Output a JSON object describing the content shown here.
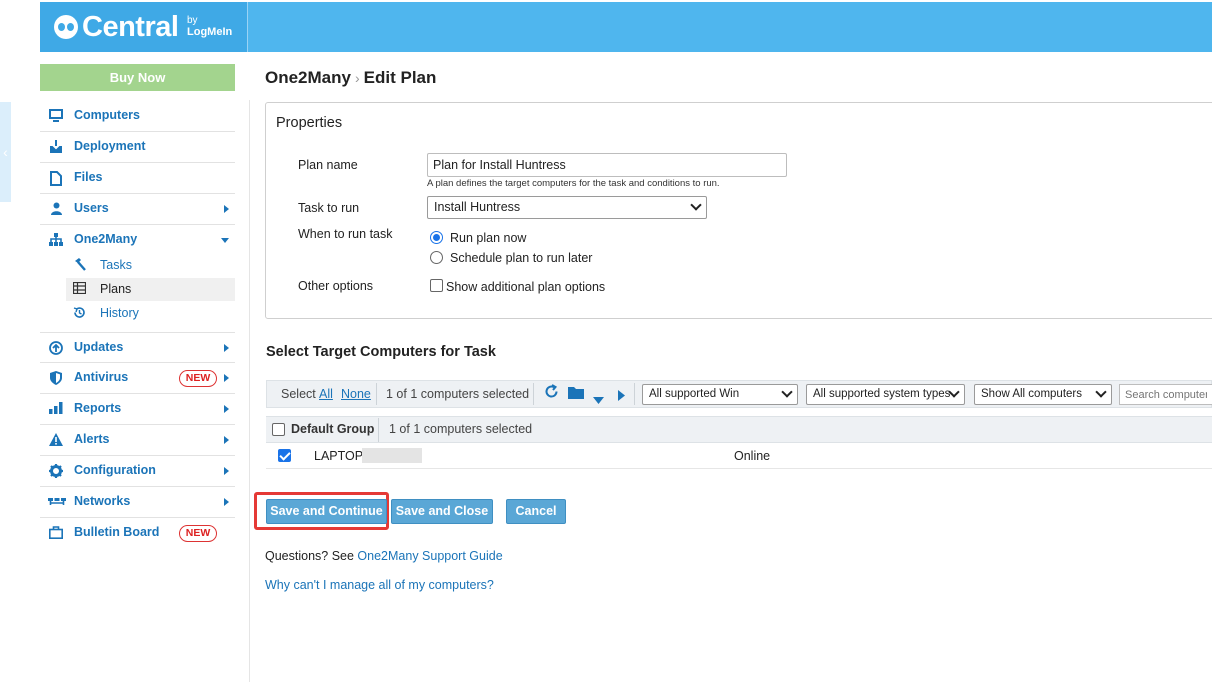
{
  "brand": {
    "name": "Central",
    "by": "by",
    "logmein": "LogMeIn"
  },
  "sidebar": {
    "collapse_glyph": "‹",
    "buy_now": "Buy Now",
    "items": [
      {
        "label": "Computers",
        "icon": "monitor-icon"
      },
      {
        "label": "Deployment",
        "icon": "download-icon"
      },
      {
        "label": "Files",
        "icon": "file-icon"
      },
      {
        "label": "Users",
        "icon": "user-icon"
      },
      {
        "label": "One2Many",
        "icon": "sitemap-icon"
      },
      {
        "label": "Updates",
        "icon": "arrow-up-circle-icon"
      },
      {
        "label": "Antivirus",
        "icon": "shield-icon",
        "badge": "NEW"
      },
      {
        "label": "Reports",
        "icon": "bar-chart-icon"
      },
      {
        "label": "Alerts",
        "icon": "warning-icon"
      },
      {
        "label": "Configuration",
        "icon": "gear-icon"
      },
      {
        "label": "Networks",
        "icon": "network-icon"
      },
      {
        "label": "Bulletin Board",
        "icon": "briefcase-icon",
        "badge": "NEW"
      }
    ],
    "subitems": [
      {
        "label": "Tasks",
        "icon": "hammer-icon"
      },
      {
        "label": "Plans",
        "icon": "table-icon",
        "active": true
      },
      {
        "label": "History",
        "icon": "history-icon"
      }
    ]
  },
  "breadcrumb": {
    "parent": "One2Many",
    "separator": "›",
    "current": "Edit Plan"
  },
  "properties": {
    "title": "Properties",
    "plan_name_label": "Plan name",
    "plan_name_value": "Plan for Install Huntress",
    "plan_name_hint": "A plan defines the target computers for the task and conditions to run.",
    "task_label": "Task to run",
    "task_value": "Install Huntress",
    "when_label": "When to run task",
    "when_options": [
      "Run plan now",
      "Schedule plan to run later"
    ],
    "when_selected": "Run plan now",
    "other_label": "Other options",
    "other_checkbox": "Show additional plan options"
  },
  "targets": {
    "title": "Select Target Computers for Task",
    "select_label": "Select",
    "select_all": "All",
    "select_none": "None",
    "selected_count": "1 of 1 computers selected",
    "filter_os": "All supported Win",
    "filter_types": "All supported system types",
    "filter_show": "Show All computers",
    "search_placeholder": "Search computers",
    "group_name": "Default Group",
    "group_count": "1 of 1 computers selected",
    "computer_name": "LAPTOP",
    "computer_status": "Online"
  },
  "actions": {
    "save_continue": "Save and Continue",
    "save_close": "Save and Close",
    "cancel": "Cancel"
  },
  "footer": {
    "questions_prefix": "Questions? See ",
    "support_link": "One2Many Support Guide",
    "manage_link": "Why can't I manage all of my computers?"
  },
  "colors": {
    "topbar": "#4fb6ee",
    "link": "#1b74b8",
    "button": "#5aa7d6",
    "buy_now": "#a3d48e",
    "badge": "#dd2222",
    "highlight": "#e53935"
  }
}
